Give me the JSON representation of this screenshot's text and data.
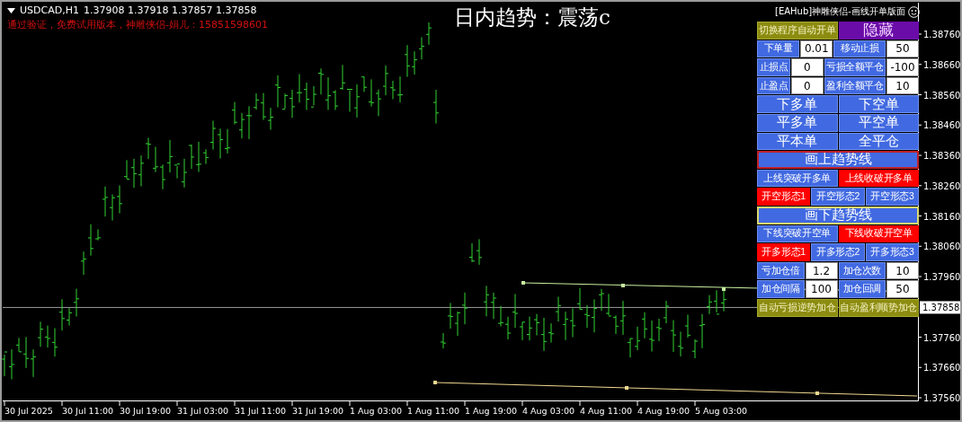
{
  "chart_header": {
    "symbol": "USDCAD,H1",
    "quote": "1.37908 1.37918 1.37857 1.37858",
    "notice": "通过验证，免费试用版本，神雕侠侣-娟儿：15851598601"
  },
  "trend_title": "日内趋势：震荡c",
  "panel": {
    "title": "[EAHub]神雕侠侣-画线开单版面",
    "rows": [
      [
        {
          "kind": "switch",
          "text": "切换程序自动开单"
        },
        {
          "kind": "hide",
          "text": "隐藏"
        }
      ],
      [
        {
          "kind": "label",
          "text": "下单量"
        },
        {
          "kind": "field",
          "text": "0.01"
        },
        {
          "kind": "label",
          "text": "移动止损"
        },
        {
          "kind": "field",
          "text": "50"
        }
      ],
      [
        {
          "kind": "label",
          "text": "止损点"
        },
        {
          "kind": "field",
          "text": "0"
        },
        {
          "kind": "label",
          "text": "亏损全额平仓"
        },
        {
          "kind": "field",
          "text": "-100"
        }
      ],
      [
        {
          "kind": "label",
          "text": "止盈点"
        },
        {
          "kind": "field",
          "text": "0"
        },
        {
          "kind": "label",
          "text": "盈利全额平仓"
        },
        {
          "kind": "field",
          "text": "10"
        }
      ],
      [
        {
          "kind": "action",
          "text": "下多单"
        },
        {
          "kind": "action",
          "text": "下空单"
        }
      ],
      [
        {
          "kind": "action",
          "text": "平多单"
        },
        {
          "kind": "action",
          "text": "平空单"
        }
      ],
      [
        {
          "kind": "action",
          "text": "平本单"
        },
        {
          "kind": "action",
          "text": "全平仓"
        }
      ],
      [
        {
          "kind": "trend",
          "text": "画上趋势线",
          "color": "#c0202a"
        }
      ],
      [
        {
          "kind": "option",
          "text": "上线突破开多单",
          "selected": false
        },
        {
          "kind": "option",
          "text": "上线收破开多单",
          "selected": true
        }
      ],
      [
        {
          "kind": "option",
          "text": "开空形态1",
          "selected": true
        },
        {
          "kind": "option",
          "text": "开空形态2",
          "selected": false
        },
        {
          "kind": "option",
          "text": "开空形态3",
          "selected": false
        }
      ],
      [
        {
          "kind": "trend",
          "text": "画下趋势线",
          "color": "#d8d870"
        }
      ],
      [
        {
          "kind": "option",
          "text": "下线突破开空单",
          "selected": false
        },
        {
          "kind": "option",
          "text": "下线收破开空单",
          "selected": true
        }
      ],
      [
        {
          "kind": "option",
          "text": "开多形态1",
          "selected": true
        },
        {
          "kind": "option",
          "text": "开多形态2",
          "selected": false
        },
        {
          "kind": "option",
          "text": "开多形态3",
          "selected": false
        }
      ],
      [
        {
          "kind": "label",
          "text": "亏加仓倍"
        },
        {
          "kind": "field",
          "text": "1.2"
        },
        {
          "kind": "label",
          "text": "加仓次数"
        },
        {
          "kind": "field",
          "text": "10"
        }
      ],
      [
        {
          "kind": "label",
          "text": "加仓间隔"
        },
        {
          "kind": "field",
          "text": "100"
        },
        {
          "kind": "label",
          "text": "加仓回调"
        },
        {
          "kind": "field",
          "text": "50"
        }
      ],
      [
        {
          "kind": "switch",
          "text": "自动亏损逆势加仓"
        },
        {
          "kind": "switch",
          "text": "自动盈利顺势加仓"
        }
      ]
    ]
  },
  "price_axis": {
    "labels": [
      "1.38760",
      "1.38660",
      "1.38560",
      "1.38460",
      "1.38360",
      "1.38260",
      "1.38160",
      "1.38060",
      "1.37960",
      "1.37760",
      "1.37660",
      "1.37560"
    ],
    "current": "1.37858"
  },
  "time_axis": {
    "labels": [
      "30 Jul 2025",
      "30 Jul 11:00",
      "30 Jul 19:00",
      "31 Jul 03:00",
      "31 Jul 11:00",
      "31 Jul 19:00",
      "1 Aug 03:00",
      "1 Aug 11:00",
      "1 Aug 19:00",
      "4 Aug 03:00",
      "4 Aug 11:00",
      "4 Aug 19:00",
      "5 Aug 03:00"
    ]
  }
}
